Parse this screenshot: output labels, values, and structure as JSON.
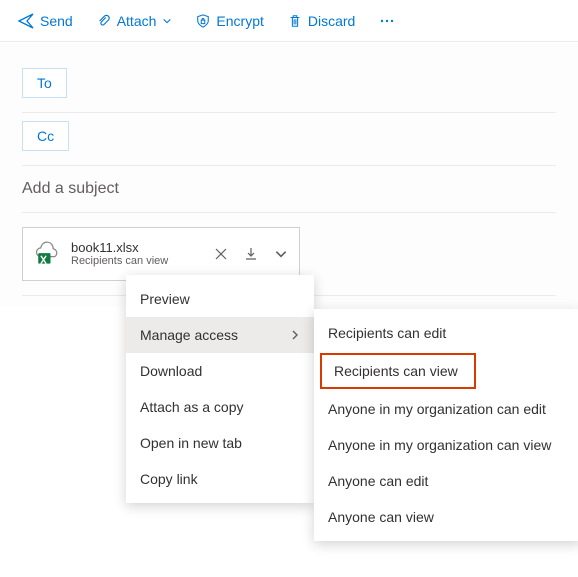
{
  "toolbar": {
    "send": "Send",
    "attach": "Attach",
    "encrypt": "Encrypt",
    "discard": "Discard"
  },
  "fields": {
    "to": "To",
    "cc": "Cc",
    "subject_placeholder": "Add a subject"
  },
  "attachment": {
    "name": "book11.xlsx",
    "status": "Recipients can view"
  },
  "menu": {
    "items": [
      {
        "label": "Preview"
      },
      {
        "label": "Manage access",
        "submenu": true
      },
      {
        "label": "Download"
      },
      {
        "label": "Attach as a copy"
      },
      {
        "label": "Open in new tab"
      },
      {
        "label": "Copy link"
      }
    ]
  },
  "submenu": {
    "items": [
      {
        "label": "Recipients can edit"
      },
      {
        "label": "Recipients can view",
        "highlighted": true
      },
      {
        "label": "Anyone in my organization can edit"
      },
      {
        "label": "Anyone in my organization can view"
      },
      {
        "label": "Anyone can edit"
      },
      {
        "label": "Anyone can view"
      }
    ]
  }
}
